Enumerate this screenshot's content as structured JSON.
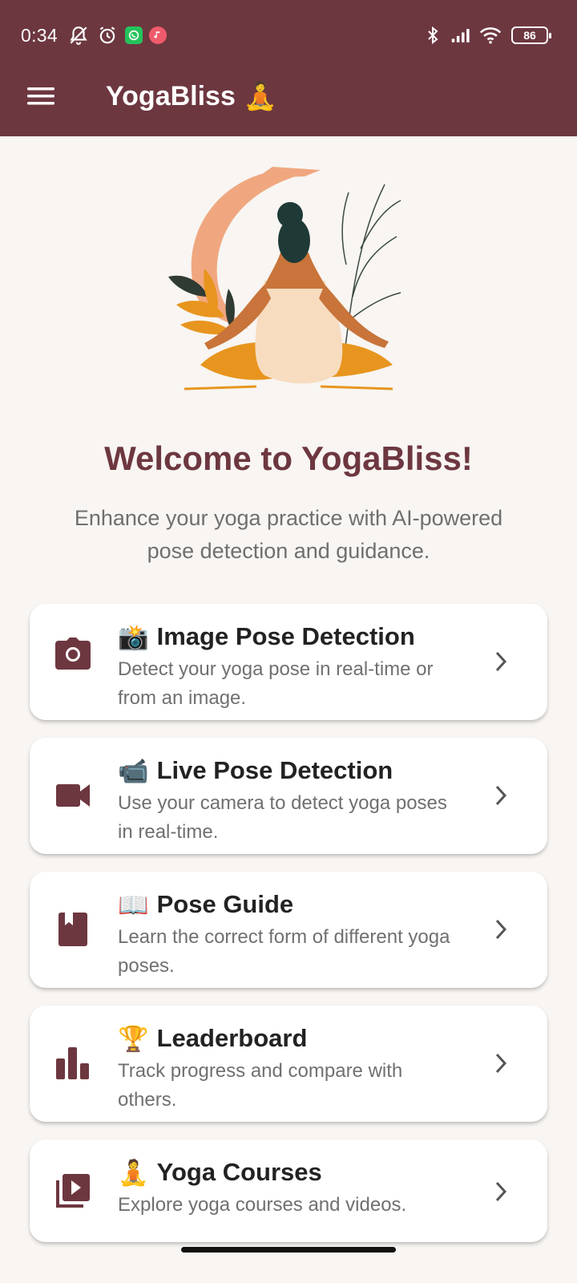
{
  "status_bar": {
    "time": "0:34",
    "battery": "86"
  },
  "app_bar": {
    "title": "YogaBliss",
    "title_emoji": "🧘",
    "menu_icon": "hamburger-menu-icon"
  },
  "welcome": {
    "heading": "Welcome to YogaBliss!",
    "subtitle": "Enhance your yoga practice with AI-powered pose detection and guidance."
  },
  "cards": [
    {
      "emoji": "📸",
      "title": "Image Pose Detection",
      "description": "Detect your yoga pose in real-time or from an image.",
      "icon": "camera-icon"
    },
    {
      "emoji": "📹",
      "title": "Live Pose Detection",
      "description": "Use your camera to detect yoga poses in real-time.",
      "icon": "videocam-icon"
    },
    {
      "emoji": "📖",
      "title": "Pose Guide",
      "description": "Learn the correct form of different yoga poses.",
      "icon": "book-icon"
    },
    {
      "emoji": "🏆",
      "title": "Leaderboard",
      "description": "Track progress and compare with others.",
      "icon": "bar-chart-icon"
    },
    {
      "emoji": "🧘",
      "title": "Yoga Courses",
      "description": "Explore yoga courses and videos.",
      "icon": "video-library-icon"
    }
  ],
  "colors": {
    "primary": "#6d3740",
    "background": "#f8f5f2",
    "card": "#ffffff",
    "accent_orange": "#e8951f",
    "accent_peach": "#f0a77f"
  }
}
